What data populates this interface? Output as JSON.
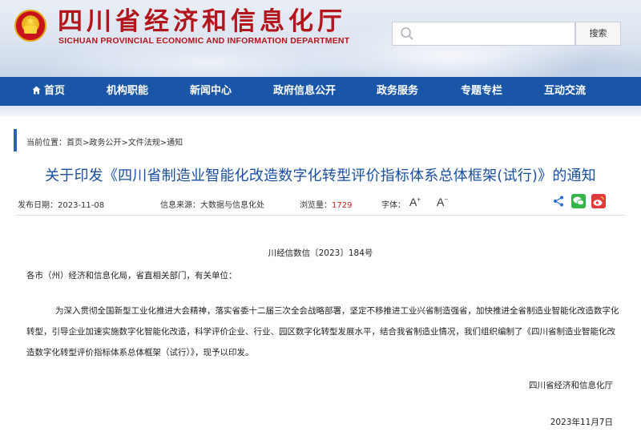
{
  "header": {
    "title": "四川省经济和信息化厅",
    "subtitle": "SICHUAN PROVINCIAL ECONOMIC AND INFORMATION DEPARTMENT",
    "search_placeholder": "",
    "search_button": "搜索"
  },
  "nav": {
    "items": [
      {
        "label": "首页"
      },
      {
        "label": "机构职能"
      },
      {
        "label": "新闻中心"
      },
      {
        "label": "政府信息公开"
      },
      {
        "label": "政务服务"
      },
      {
        "label": "专题专栏"
      },
      {
        "label": "互动交流"
      }
    ],
    "color": "#1a56a8"
  },
  "breadcrumb": {
    "prefix": "当前位置：",
    "items": [
      "首页",
      "政务公开",
      "文件法规",
      "通知"
    ],
    "separator": ">"
  },
  "article": {
    "title": "关于印发《四川省制造业智能化改造数字化转型评价指标体系总体框架(试行)》的通知",
    "publish_label": "发布日期：",
    "publish_date": "2023-11-08",
    "source_label": "信息来源：",
    "source": "大数据与信息化处",
    "views_label": "浏览量：",
    "views": "1729",
    "font_label": "字体：",
    "font_increase": "A",
    "font_decrease": "A",
    "doc_number": "川经信数信〔2023〕184号",
    "salutation": "各市（州）经济和信息化局，省直相关部门，有关单位：",
    "paragraph": "为深入贯彻全国新型工业化推进大会精神，落实省委十二届三次全会战略部署，坚定不移推进工业兴省制造强省，加快推进全省制造业智能化改造数字化转型，引导企业加速实施数字化智能化改造，科学评价企业、行业、园区数字化转型发展水平，结合我省制造业情况，我们组织编制了《四川省制造业智能化改造数字化转型评价指标体系总体框架（试行）》，现予以印发。",
    "signature": "四川省经济和信息化厅",
    "sign_date": "2023年11月7日"
  },
  "colors": {
    "title_red": "#b3151c",
    "link_blue": "#1a4fa0",
    "views_red": "#d02020"
  },
  "icons": [
    "national-emblem",
    "search-icon",
    "home-icon",
    "share-icon",
    "wechat-icon",
    "weibo-icon"
  ]
}
